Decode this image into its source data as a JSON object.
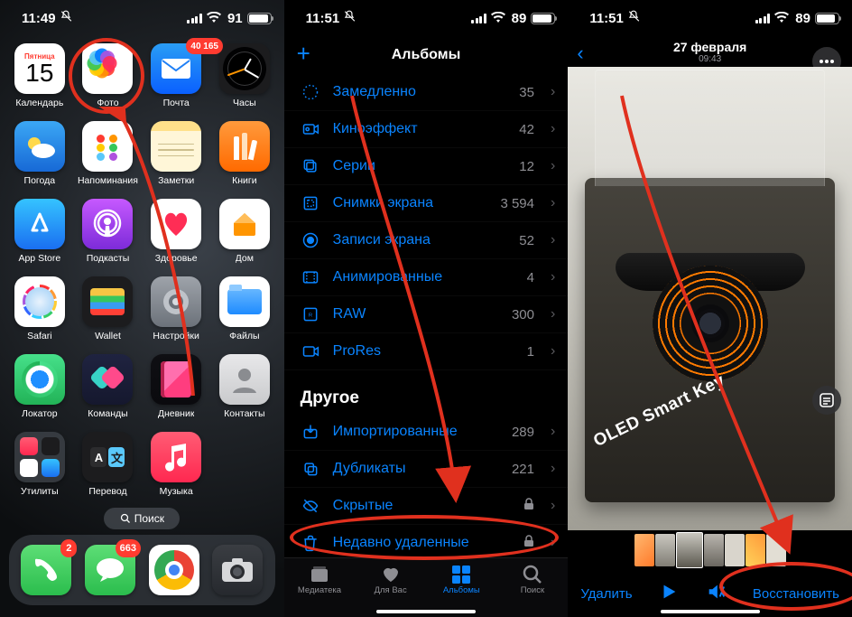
{
  "phone1": {
    "status": {
      "time": "11:49",
      "battery_pct": "91"
    },
    "calendar_day": "Пятница",
    "calendar_num": "15",
    "apps": {
      "calendar": "Календарь",
      "photos": "Фото",
      "mail": "Почта",
      "clock": "Часы",
      "weather": "Погода",
      "reminders": "Напоминания",
      "notes": "Заметки",
      "books": "Книги",
      "appstore": "App Store",
      "podcasts": "Подкасты",
      "health": "Здоровье",
      "home": "Дом",
      "safari": "Safari",
      "wallet": "Wallet",
      "settings": "Настройки",
      "files": "Файлы",
      "findmy": "Локатор",
      "shortcuts": "Команды",
      "journal": "Дневник",
      "contacts": "Контакты",
      "utilities": "Утилиты",
      "translate": "Перевод",
      "music": "Музыка"
    },
    "badges": {
      "mail": "40 165",
      "phone": "2",
      "messages": "663"
    },
    "search": "Поиск"
  },
  "phone2": {
    "status": {
      "time": "11:51",
      "battery_pct": "89"
    },
    "title": "Альбомы",
    "media_types": [
      {
        "label": "Замедленно",
        "count": "35"
      },
      {
        "label": "Киноэффект",
        "count": "42"
      },
      {
        "label": "Серии",
        "count": "12"
      },
      {
        "label": "Снимки экрана",
        "count": "3 594"
      },
      {
        "label": "Записи экрана",
        "count": "52"
      },
      {
        "label": "Анимированные",
        "count": "4"
      },
      {
        "label": "RAW",
        "count": "300"
      },
      {
        "label": "ProRes",
        "count": "1"
      }
    ],
    "other_title": "Другое",
    "other": [
      {
        "label": "Импортированные",
        "count": "289"
      },
      {
        "label": "Дубликаты",
        "count": "221"
      },
      {
        "label": "Скрытые",
        "locked": true
      },
      {
        "label": "Недавно удаленные",
        "locked": true
      }
    ],
    "tabs": {
      "library": "Медиатека",
      "foryou": "Для Вас",
      "albums": "Альбомы",
      "search": "Поиск"
    }
  },
  "phone3": {
    "status": {
      "time": "11:51",
      "battery_pct": "89"
    },
    "date": "27 февраля",
    "photo_time": "09:43",
    "oled_text": "OLED Smart Key",
    "delete": "Удалить",
    "restore": "Восстановить"
  }
}
